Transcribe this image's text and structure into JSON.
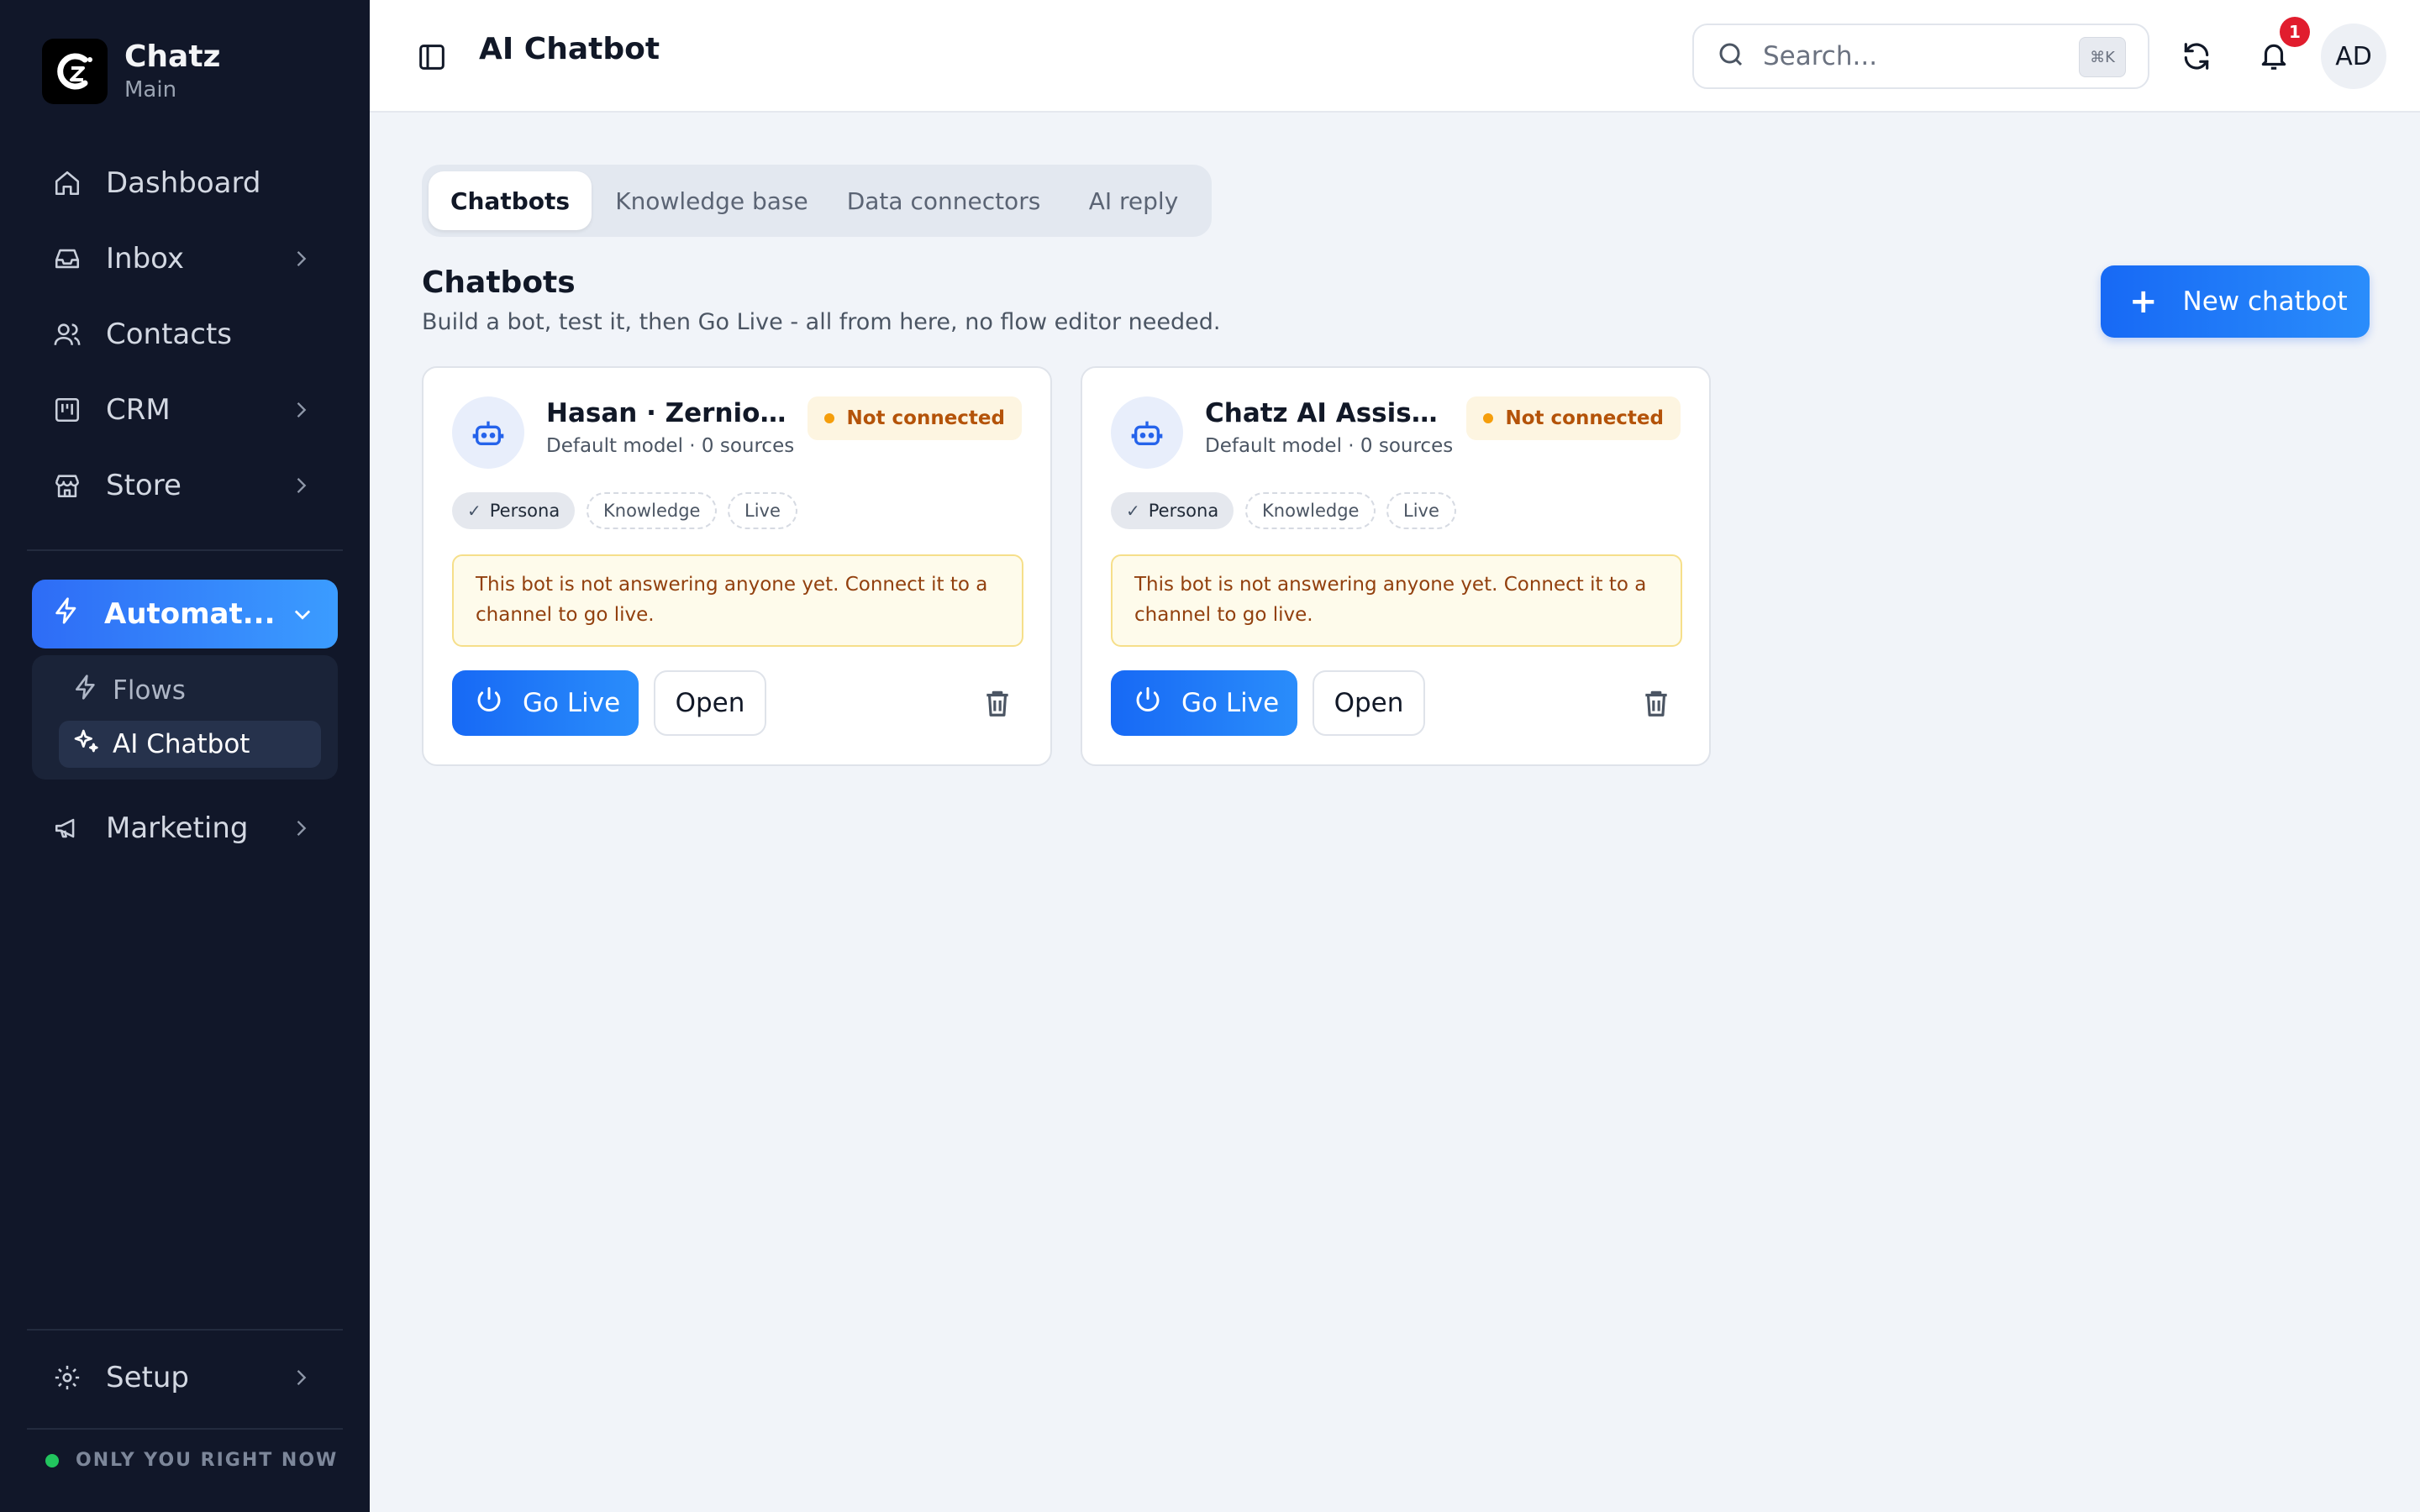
{
  "brand": {
    "name": "Chatz",
    "workspace": "Main"
  },
  "sidebar": {
    "items": [
      {
        "label": "Dashboard",
        "icon": "home-icon"
      },
      {
        "label": "Inbox",
        "icon": "inbox-icon"
      },
      {
        "label": "Contacts",
        "icon": "users-icon"
      },
      {
        "label": "CRM",
        "icon": "kanban-icon"
      },
      {
        "label": "Store",
        "icon": "store-icon"
      }
    ],
    "active_group": {
      "label": "Automat...",
      "icon": "zap-icon"
    },
    "sub_items": [
      {
        "label": "Flows",
        "icon": "zap-icon"
      },
      {
        "label": "AI Chatbot",
        "icon": "sparkles-icon"
      }
    ],
    "marketing": {
      "label": "Marketing",
      "icon": "megaphone-icon"
    },
    "setup": {
      "label": "Setup",
      "icon": "gear-icon"
    },
    "status": "ONLY YOU RIGHT NOW"
  },
  "header": {
    "title": "AI Chatbot",
    "search_placeholder": "Search...",
    "shortcut": "⌘K",
    "notification_count": "1",
    "avatar_initials": "AD"
  },
  "tabs": [
    {
      "label": "Chatbots",
      "active": true
    },
    {
      "label": "Knowledge base",
      "active": false
    },
    {
      "label": "Data connectors",
      "active": false
    },
    {
      "label": "AI reply",
      "active": false
    }
  ],
  "section": {
    "title": "Chatbots",
    "subtitle": "Build a bot, test it, then Go Live - all from here, no flow editor needed.",
    "new_button": "New chatbot"
  },
  "cards": [
    {
      "name": "Hasan · Zernio ...",
      "meta": "Default model · 0 sources",
      "status": "Not connected",
      "chips": [
        "Persona",
        "Knowledge",
        "Live"
      ],
      "warning": "This bot is not answering anyone yet. Connect it to a channel to go live.",
      "go_live": "Go Live",
      "open": "Open"
    },
    {
      "name": "Chatz AI Assist...",
      "meta": "Default model · 0 sources",
      "status": "Not connected",
      "chips": [
        "Persona",
        "Knowledge",
        "Live"
      ],
      "warning": "This bot is not answering anyone yet. Connect it to a channel to go live.",
      "go_live": "Go Live",
      "open": "Open"
    }
  ],
  "colors": {
    "sidebar_bg": "#111729",
    "accent": "#1769f5",
    "warning_bg": "#fefbeb",
    "warning_text": "#92400e",
    "status_text": "#b45309",
    "badge": "#e11d2e"
  }
}
